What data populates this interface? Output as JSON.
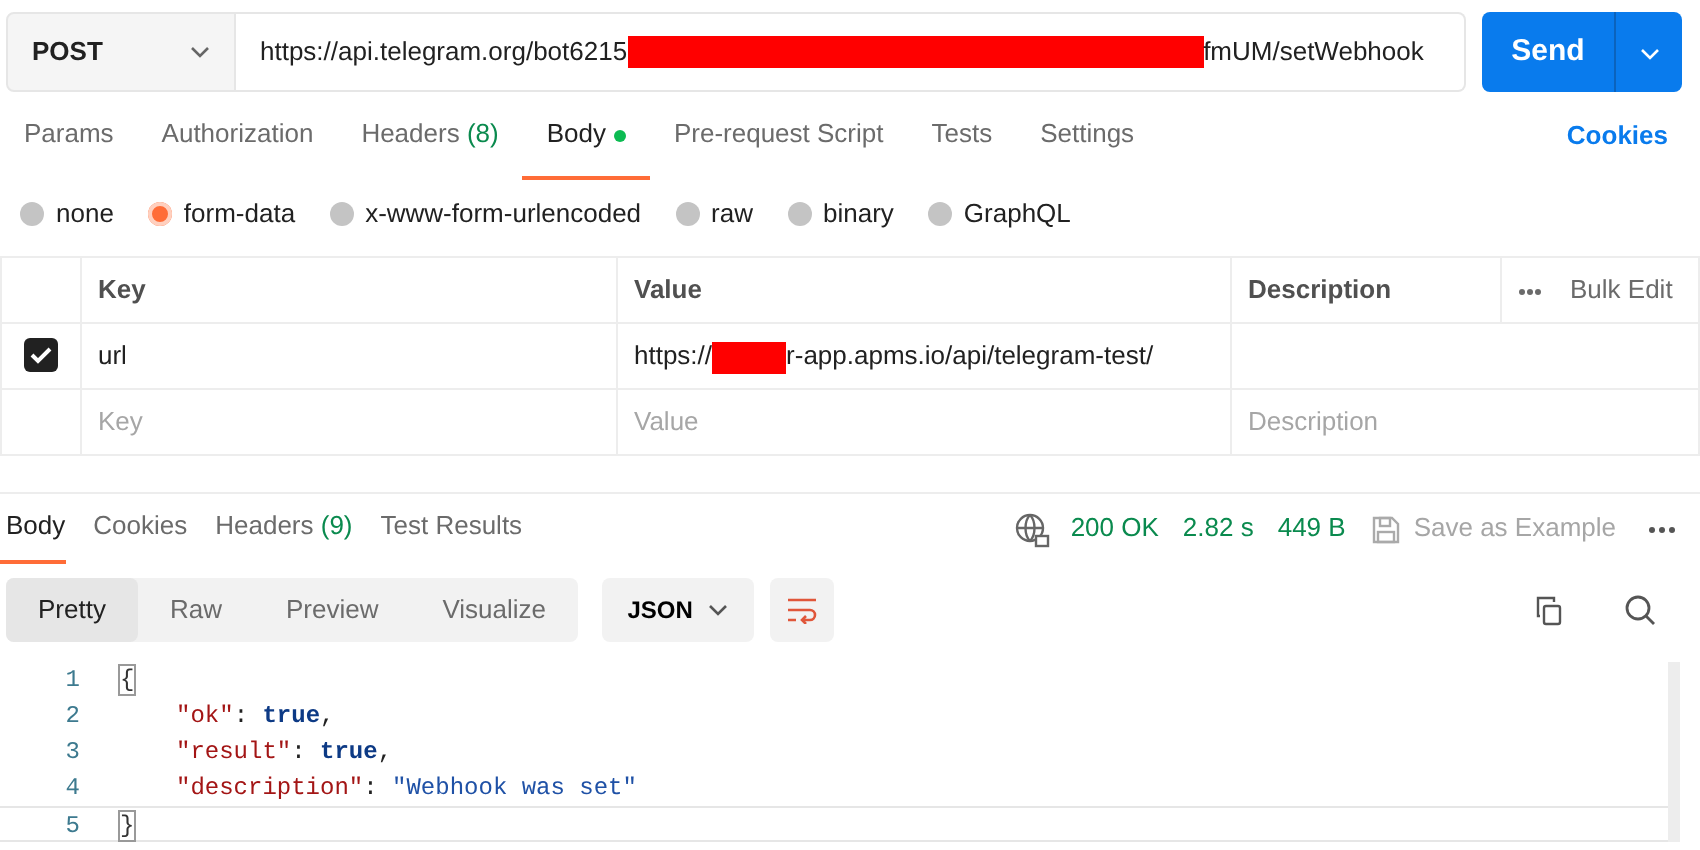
{
  "request": {
    "method": "POST",
    "url_start": "https://api.telegram.org/bot6215",
    "url_end": "fmUM/setWebhook",
    "send": "Send"
  },
  "request_tabs": [
    {
      "label": "Params",
      "selected": false
    },
    {
      "label": "Authorization",
      "selected": false
    },
    {
      "label": "Headers",
      "count": "(8)",
      "selected": false
    },
    {
      "label": "Body",
      "selected": true,
      "dot": true
    },
    {
      "label": "Pre-request Script",
      "selected": false
    },
    {
      "label": "Tests",
      "selected": false
    },
    {
      "label": "Settings",
      "selected": false
    }
  ],
  "cookies_link": "Cookies",
  "body_types": [
    {
      "label": "none",
      "selected": false
    },
    {
      "label": "form-data",
      "selected": true
    },
    {
      "label": "x-www-form-urlencoded",
      "selected": false
    },
    {
      "label": "raw",
      "selected": false
    },
    {
      "label": "binary",
      "selected": false
    },
    {
      "label": "GraphQL",
      "selected": false
    }
  ],
  "table": {
    "columns": [
      "Key",
      "Value",
      "Description"
    ],
    "bulk_edit": "Bulk Edit",
    "rows": [
      {
        "checked": true,
        "key": "url",
        "value_start": "https://",
        "value_end": "r-app.apms.io/api/telegram-test/"
      }
    ],
    "placeholder_row": {
      "key": "Key",
      "value": "Value",
      "description": "Description"
    }
  },
  "response_tabs": [
    {
      "label": "Body",
      "selected": true
    },
    {
      "label": "Cookies",
      "selected": false
    },
    {
      "label": "Headers",
      "count": "(9)",
      "selected": false
    },
    {
      "label": "Test Results",
      "selected": false
    }
  ],
  "status": {
    "code": "200 OK",
    "time": "2.82 s",
    "size": "449 B",
    "save": "Save as Example"
  },
  "view_modes": [
    {
      "label": "Pretty",
      "selected": true
    },
    {
      "label": "Raw",
      "selected": false
    },
    {
      "label": "Preview",
      "selected": false
    },
    {
      "label": "Visualize",
      "selected": false
    }
  ],
  "format": "JSON",
  "code": [
    {
      "number": "1",
      "tokens": [
        {
          "kind": "bracket",
          "text": "{"
        }
      ]
    },
    {
      "number": "2",
      "tokens": [
        {
          "kind": "key",
          "text": "\"ok\""
        },
        {
          "kind": "punct",
          "text": ": "
        },
        {
          "kind": "literal",
          "text": "true"
        },
        {
          "kind": "punct",
          "text": ","
        }
      ]
    },
    {
      "number": "3",
      "tokens": [
        {
          "kind": "key",
          "text": "\"result\""
        },
        {
          "kind": "punct",
          "text": ": "
        },
        {
          "kind": "literal",
          "text": "true"
        },
        {
          "kind": "punct",
          "text": ","
        }
      ]
    },
    {
      "number": "4",
      "tokens": [
        {
          "kind": "key",
          "text": "\"description\""
        },
        {
          "kind": "punct",
          "text": ": "
        },
        {
          "kind": "string",
          "text": "\"Webhook was set\""
        }
      ]
    },
    {
      "number": "5",
      "tokens": [
        {
          "kind": "bracket",
          "text": "}"
        }
      ],
      "current": true
    }
  ]
}
